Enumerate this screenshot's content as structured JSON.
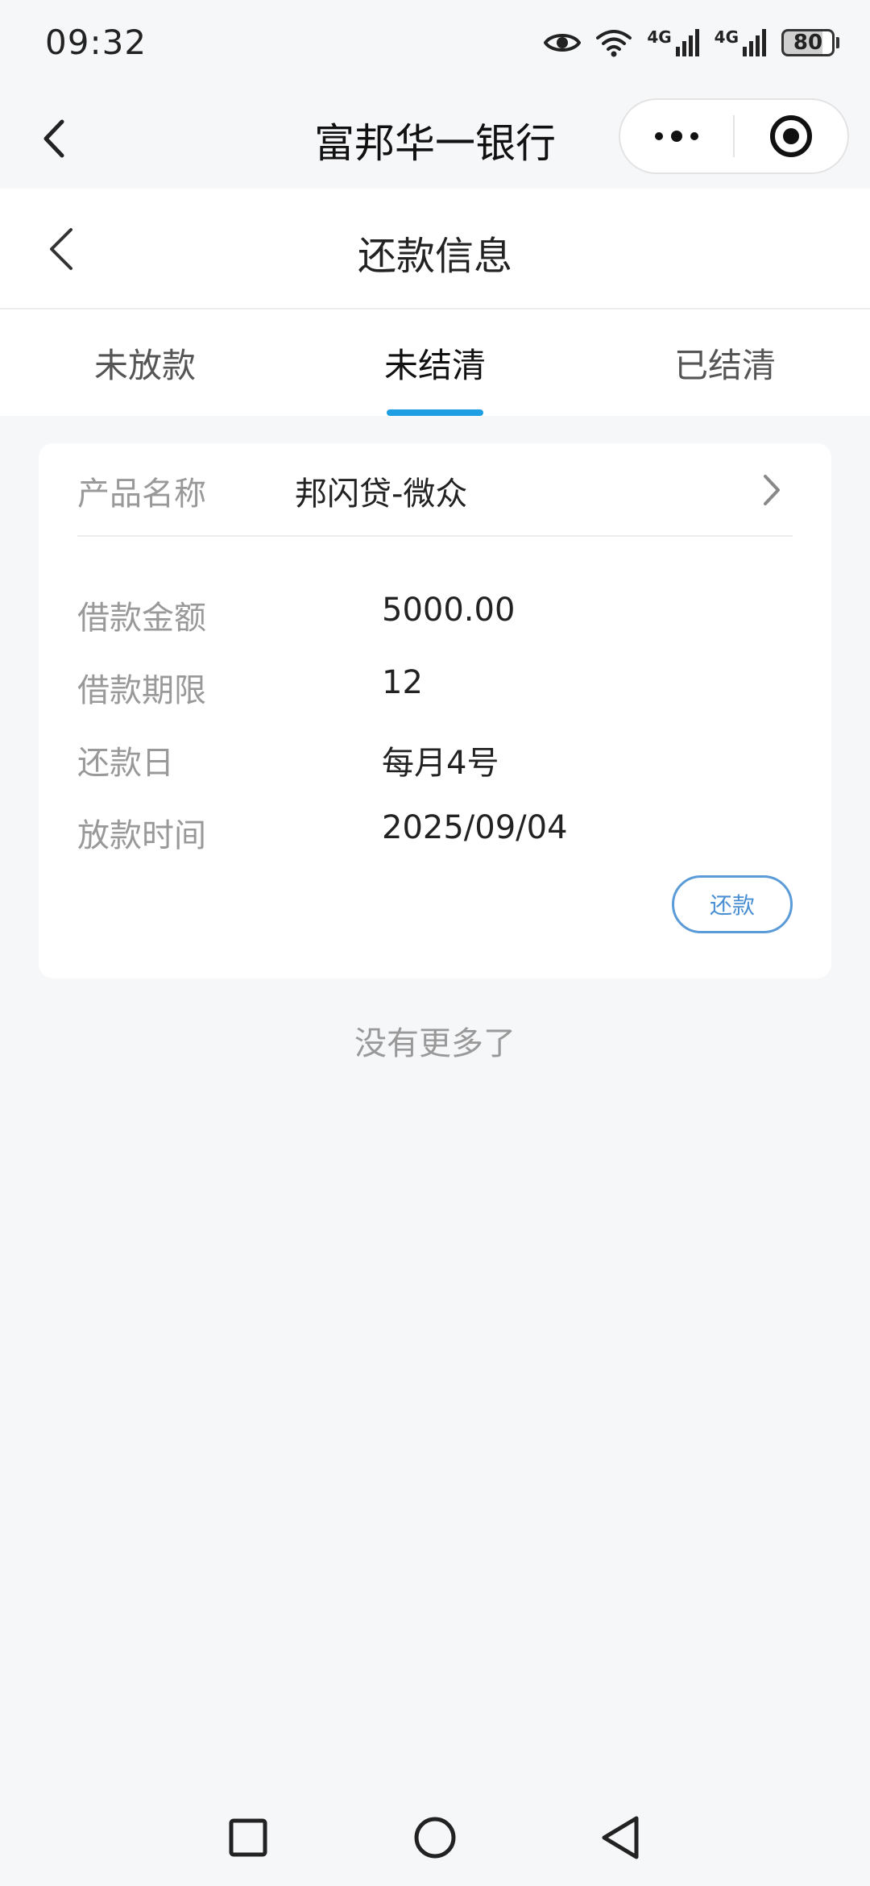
{
  "status_bar": {
    "time": "09:32",
    "network_1": "4G",
    "network_2": "4G",
    "battery": "80"
  },
  "navbar": {
    "title": "富邦华一银行"
  },
  "page": {
    "title": "还款信息"
  },
  "tabs": [
    {
      "label": "未放款",
      "active": false
    },
    {
      "label": "未结清",
      "active": true
    },
    {
      "label": "已结清",
      "active": false
    }
  ],
  "loan_card": {
    "product_label": "产品名称",
    "product_name": "邦闪贷-微众",
    "rows": [
      {
        "label": "借款金额",
        "value": "5000.00"
      },
      {
        "label": "借款期限",
        "value": "12"
      },
      {
        "label": "还款日",
        "value": "每月4号"
      },
      {
        "label": "放款时间",
        "value": "2025/09/04"
      }
    ],
    "repay_button": "还款"
  },
  "footer_text": "没有更多了",
  "colors": {
    "accent": "#1e9fe3",
    "button_border": "#5a9bd8",
    "background": "#f6f7f9"
  }
}
